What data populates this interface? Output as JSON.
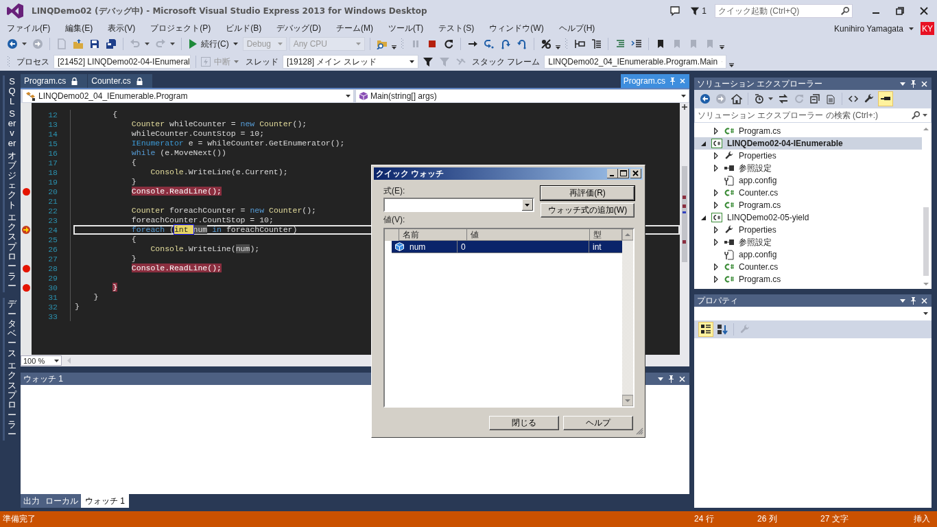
{
  "window": {
    "title": "LINQDemo02 (デバッグ中) - Microsoft Visual Studio Express 2013 for Windows Desktop"
  },
  "title_bar": {
    "notification_count": "1",
    "quick_launch": {
      "placeholder": "クイック起動 (Ctrl+Q)"
    }
  },
  "menu": [
    "ファイル(F)",
    "編集(E)",
    "表示(V)",
    "プロジェクト(P)",
    "ビルド(B)",
    "デバッグ(D)",
    "チーム(M)",
    "ツール(T)",
    "テスト(S)",
    "ウィンドウ(W)",
    "ヘルプ(H)"
  ],
  "user": {
    "name": "Kunihiro Yamagata",
    "initials": "KY"
  },
  "debug_toolbar": {
    "continue": "続行(C)",
    "configuration": {
      "value": "Debug",
      "disabled": true
    },
    "platform": {
      "value": "Any CPU",
      "disabled": true
    }
  },
  "location_toolbar": {
    "process_label": "プロセス",
    "process": "[21452] LINQDemo02-04-IEnumeral",
    "break": {
      "label": "中断",
      "disabled": true
    },
    "thread_label": "スレッド",
    "thread": "[19128] メイン スレッド",
    "stack_frame_label": "スタック フレーム",
    "stack_frame": "LINQDemo02_04_IEnumerable.Program.Main"
  },
  "side_tabs": [
    {
      "words": [
        "SQL",
        "Server",
        "オブジェクト",
        "エクスプローラー"
      ]
    },
    {
      "words": [
        "データベース",
        "エクスプローラー"
      ]
    }
  ],
  "editor": {
    "tabs": [
      {
        "label": "Program.cs",
        "kind": "document",
        "selected": false
      },
      {
        "label": "Counter.cs",
        "kind": "document",
        "selected": false
      },
      {
        "label": "Program.cs",
        "kind": "preview",
        "selected": true
      }
    ],
    "type_dropdown": "LINQDemo02_04_IEnumerable.Program",
    "member_dropdown": "Main(string[] args)",
    "zoom": "100 %",
    "lines": [
      {
        "number": "12",
        "breakpoint": false,
        "current": false,
        "tokens": [
          {
            "text": "        {",
            "kind": "plain"
          }
        ]
      },
      {
        "number": "13",
        "breakpoint": false,
        "current": false,
        "tokens": [
          {
            "text": "            Counter",
            "kind": "type"
          },
          {
            "text": " whileCounter = ",
            "kind": "plain"
          },
          {
            "text": "new ",
            "kind": "keyword"
          },
          {
            "text": "Counter",
            "kind": "type"
          },
          {
            "text": "();",
            "kind": "plain"
          }
        ]
      },
      {
        "number": "14",
        "breakpoint": false,
        "current": false,
        "tokens": [
          {
            "text": "            whileCounter.CountStop = 10;",
            "kind": "plain"
          }
        ]
      },
      {
        "number": "15",
        "breakpoint": false,
        "current": false,
        "tokens": [
          {
            "text": "            IEnumerator",
            "kind": "interface"
          },
          {
            "text": " e = whileCounter.GetEnumerator();",
            "kind": "plain"
          }
        ]
      },
      {
        "number": "16",
        "breakpoint": false,
        "current": false,
        "tokens": [
          {
            "text": "            while",
            "kind": "keyword"
          },
          {
            "text": " (e.MoveNext())",
            "kind": "plain"
          }
        ]
      },
      {
        "number": "17",
        "breakpoint": false,
        "current": false,
        "tokens": [
          {
            "text": "            {",
            "kind": "plain"
          }
        ]
      },
      {
        "number": "18",
        "breakpoint": false,
        "current": false,
        "tokens": [
          {
            "text": "                Console",
            "kind": "type"
          },
          {
            "text": ".WriteLine(e.Current);",
            "kind": "plain"
          }
        ]
      },
      {
        "number": "19",
        "breakpoint": false,
        "current": false,
        "tokens": [
          {
            "text": "            }",
            "kind": "plain"
          }
        ]
      },
      {
        "number": "20",
        "breakpoint": true,
        "current": false,
        "tokens": [
          {
            "text": "            Console",
            "kind": "type"
          },
          {
            "text": ".ReadLine();",
            "kind": "plain"
          }
        ]
      },
      {
        "number": "21",
        "breakpoint": false,
        "current": false
      },
      {
        "number": "22",
        "breakpoint": false,
        "current": false,
        "tokens": [
          {
            "text": "            Counter",
            "kind": "type"
          },
          {
            "text": " foreachCounter = ",
            "kind": "plain"
          },
          {
            "text": "new ",
            "kind": "keyword"
          },
          {
            "text": "Counter",
            "kind": "type"
          },
          {
            "text": "();",
            "kind": "plain"
          }
        ]
      },
      {
        "number": "23",
        "breakpoint": false,
        "current": false,
        "tokens": [
          {
            "text": "            foreachCounter.CountStop = 10;",
            "kind": "plain"
          }
        ]
      },
      {
        "number": "24",
        "breakpoint": false,
        "current": true,
        "tokens": [
          {
            "text": "            foreach",
            "kind": "keyword"
          },
          {
            "text": " (",
            "kind": "plain"
          },
          {
            "text": "int ",
            "kind": "step"
          },
          {
            "text": "num",
            "kind": "reference"
          },
          {
            "text": " in",
            "kind": "keyword"
          },
          {
            "text": " foreachCounter)",
            "kind": "plain"
          }
        ]
      },
      {
        "number": "25",
        "breakpoint": false,
        "current": false,
        "tokens": [
          {
            "text": "            {",
            "kind": "plain"
          }
        ]
      },
      {
        "number": "26",
        "breakpoint": false,
        "current": false,
        "tokens": [
          {
            "text": "                Console",
            "kind": "type"
          },
          {
            "text": ".WriteLine(",
            "kind": "plain"
          },
          {
            "text": "num",
            "kind": "reference"
          },
          {
            "text": ");",
            "kind": "plain"
          }
        ]
      },
      {
        "number": "27",
        "breakpoint": false,
        "current": false,
        "tokens": [
          {
            "text": "            }",
            "kind": "plain"
          }
        ]
      },
      {
        "number": "28",
        "breakpoint": true,
        "current": false,
        "tokens": [
          {
            "text": "            Console",
            "kind": "type"
          },
          {
            "text": ".ReadLine();",
            "kind": "plain"
          }
        ]
      },
      {
        "number": "29",
        "breakpoint": false,
        "current": false
      },
      {
        "number": "30",
        "breakpoint": true,
        "current": false,
        "tokens": [
          {
            "text": "        }",
            "kind": "plain"
          }
        ]
      },
      {
        "number": "31",
        "breakpoint": false,
        "current": false,
        "tokens": [
          {
            "text": "    }",
            "kind": "plain"
          }
        ]
      },
      {
        "number": "32",
        "breakpoint": false,
        "current": false,
        "tokens": [
          {
            "text": "}",
            "kind": "plain"
          }
        ]
      },
      {
        "number": "33",
        "breakpoint": false,
        "current": false
      }
    ]
  },
  "watch_panel": {
    "title": "ウォッチ 1",
    "tabs": [
      {
        "label": "出力",
        "selected": false
      },
      {
        "label": "ローカル",
        "selected": false
      },
      {
        "label": "ウォッチ 1",
        "selected": true
      }
    ]
  },
  "solution_explorer": {
    "title": "ソリューション エクスプローラー",
    "search": {
      "placeholder": "ソリューション エクスプローラー の検索 (Ctrl+:)"
    },
    "leading_items": [
      {
        "label": "Program.cs",
        "kind": "csharp-file",
        "expanded": false,
        "selected": false
      }
    ],
    "tree": [
      {
        "label": "LINQDemo02-04-IEnumerable",
        "kind": "project",
        "expanded": true,
        "selected": true,
        "startup": true,
        "children": [
          {
            "label": "Properties",
            "kind": "properties",
            "expanded": false,
            "selected": false
          },
          {
            "label": "参照設定",
            "kind": "references",
            "expanded": false,
            "selected": false
          },
          {
            "label": "app.config",
            "kind": "config",
            "selected": false
          },
          {
            "label": "Counter.cs",
            "kind": "csharp-file",
            "expanded": false,
            "selected": false
          },
          {
            "label": "Program.cs",
            "kind": "csharp-file",
            "expanded": false,
            "selected": false
          }
        ]
      },
      {
        "label": "LINQDemo02-05-yield",
        "kind": "project",
        "expanded": true,
        "selected": false,
        "startup": false,
        "children": [
          {
            "label": "Properties",
            "kind": "properties",
            "expanded": false,
            "selected": false
          },
          {
            "label": "参照設定",
            "kind": "references",
            "expanded": false,
            "selected": false
          },
          {
            "label": "app.config",
            "kind": "config",
            "selected": false
          },
          {
            "label": "Counter.cs",
            "kind": "csharp-file",
            "expanded": false,
            "selected": false
          },
          {
            "label": "Program.cs",
            "kind": "csharp-file",
            "expanded": false,
            "selected": false
          }
        ]
      }
    ]
  },
  "properties": {
    "title": "プロパティ"
  },
  "quick_watch": {
    "title": "クイック ウォッチ",
    "expression_label": "式(E):",
    "value_label": "値(V):",
    "reevaluate": "再評価(R)",
    "add_watch": "ウォッチ式の追加(W)",
    "columns": [
      "名前",
      "値",
      "型"
    ],
    "rows": [
      {
        "name": "num",
        "value": "0",
        "type": "int",
        "selected": true
      }
    ],
    "close": "閉じる",
    "help": "ヘルプ"
  },
  "status_bar": {
    "message": "準備完了",
    "line": "24 行",
    "column": "26 列",
    "characters": "27 文字",
    "mode": "挿入"
  }
}
